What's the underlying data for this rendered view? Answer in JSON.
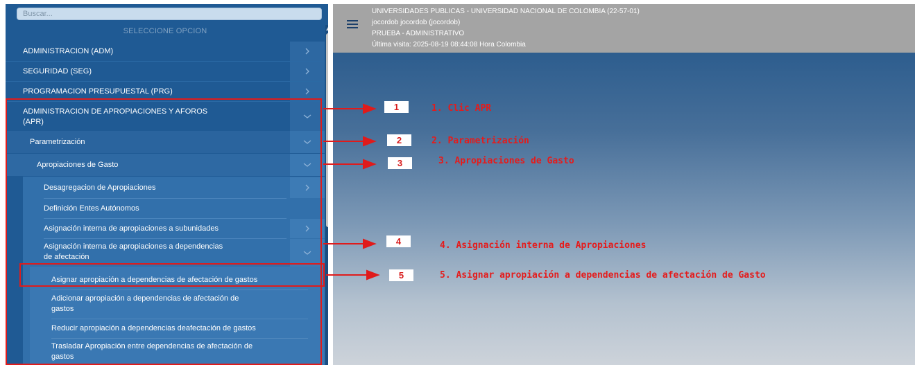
{
  "sidebar": {
    "search_placeholder": "Buscar...",
    "section_title": "SELECCIONE OPCION",
    "items": [
      {
        "label": "ADMINISTRACION (ADM)",
        "chevron": "right"
      },
      {
        "label": "SEGURIDAD (SEG)",
        "chevron": "right"
      },
      {
        "label": "PROGRAMACION PRESUPUESTAL (PRG)",
        "chevron": "right"
      },
      {
        "label_line1": "ADMINISTRACION DE APROPIACIONES Y AFOROS",
        "label_line2": "(APR)",
        "chevron": "down"
      },
      {
        "label": "Parametrización",
        "chevron": "down"
      },
      {
        "label": "Apropiaciones de Gasto",
        "chevron": "down"
      },
      {
        "label": "Desagregacion de Apropiaciones",
        "chevron": "right"
      },
      {
        "label": "Definición Entes Autónomos"
      },
      {
        "label": "Asignación interna de apropiaciones a subunidades",
        "chevron": "right"
      },
      {
        "label_line1": "Asignación interna de apropiaciones a dependencias",
        "label_line2": "de afectación",
        "chevron": "down"
      },
      {
        "label": "Asignar apropiación a dependencias de afectación de gastos"
      },
      {
        "label_line1": "Adicionar apropiación a dependencias de afectación de",
        "label_line2": "gastos"
      },
      {
        "label": "Reducir apropiación a dependencias deafectación de gastos"
      },
      {
        "label_line1": "Trasladar Apropiación entre dependencias de afectación de",
        "label_line2": "gastos"
      }
    ]
  },
  "header": {
    "institution": "UNIVERSIDADES PUBLICAS - UNIVERSIDAD NACIONAL DE COLOMBIA (22-57-01)",
    "user": "jocordob jocordob (jocordob)",
    "role": "PRUEBA - ADMINISTRATIVO",
    "last_visit": "Última visita: 2025-08-19 08:44:08 Hora Colombia"
  },
  "annotations": [
    {
      "number": "1",
      "text": "1. Clic APR"
    },
    {
      "number": "2",
      "text": "2. Parametrización"
    },
    {
      "number": "3",
      "text": "3. Apropiaciones de Gasto"
    },
    {
      "number": "4",
      "text": "4. Asignación interna de Apropiaciones"
    },
    {
      "number": "5",
      "text": "5. Asignar apropiación a dependencias de afectación de Gasto"
    }
  ],
  "colors": {
    "sidebar_bg": "#1f5a94",
    "submenu_bg": "#2c6aa3",
    "annotation_red": "#e01b1b",
    "header_bg": "#a4a4a4"
  },
  "icons": {
    "menu": "hamburger-icon",
    "collapsed": "chevron-right-icon",
    "expanded": "chevron-down-icon"
  }
}
